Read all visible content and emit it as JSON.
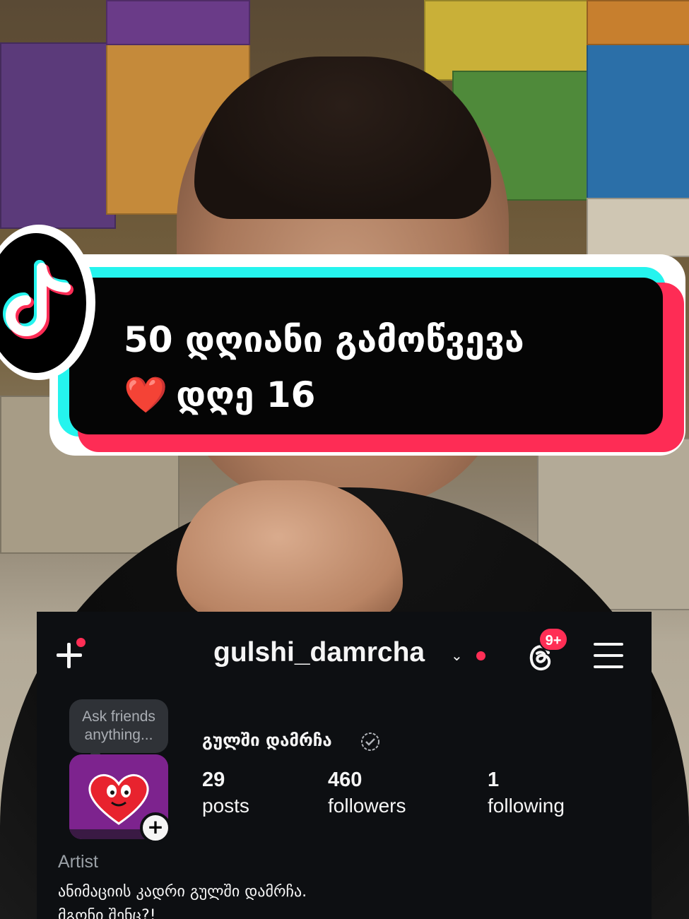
{
  "overlay": {
    "title_line1": "50 დღიანი გამოწვევა",
    "title_heart": "❤️",
    "title_line2": "დღე 16"
  },
  "profile": {
    "username": "gulshi_damrcha",
    "notification_badge": "9+",
    "note_text": "Ask friends anything...",
    "display_name": "გულში დამრჩა",
    "stats": [
      {
        "value": "29",
        "label": "posts"
      },
      {
        "value": "460",
        "label": "followers"
      },
      {
        "value": "1",
        "label": "following"
      }
    ],
    "category": "Artist",
    "bio_line1": "ანიმაციის კადრი გულში დამრჩა.",
    "bio_line2": "მგონი შენც?!"
  },
  "colors": {
    "tiktok_cyan": "#25f4ee",
    "tiktok_red": "#fe2c55",
    "ig_background": "#0d0f12",
    "notification_red": "#ff2e55"
  },
  "icons": {
    "create": "plus-icon",
    "threads": "threads-icon",
    "menu": "hamburger-menu-icon",
    "verified": "verified-badge-icon",
    "brand": "tiktok-logo-icon"
  }
}
